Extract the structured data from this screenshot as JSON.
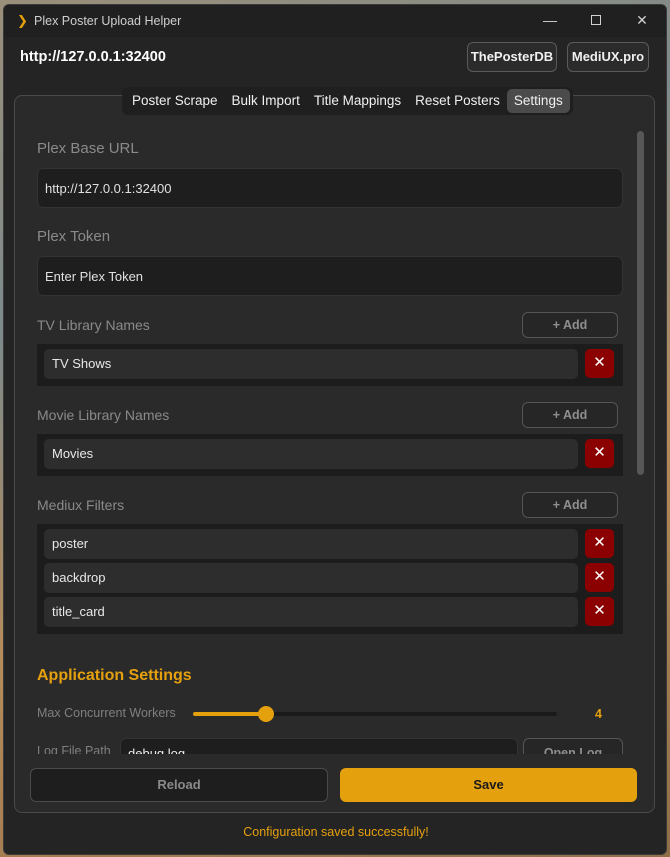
{
  "window": {
    "title": "Plex Poster Upload Helper",
    "icon": "plex-chevron-icon",
    "controls": {
      "minimize": "—",
      "close": "✕"
    }
  },
  "header": {
    "server_url": "http://127.0.0.1:32400",
    "buttons": {
      "theposterdb": "ThePosterDB",
      "mediux": "MediUX.pro"
    }
  },
  "tabs": [
    {
      "label": "Poster Scrape",
      "active": false
    },
    {
      "label": "Bulk Import",
      "active": false
    },
    {
      "label": "Title Mappings",
      "active": false
    },
    {
      "label": "Reset Posters",
      "active": false
    },
    {
      "label": "Settings",
      "active": true
    }
  ],
  "settings": {
    "plex_base_url": {
      "label": "Plex Base URL",
      "value": "http://127.0.0.1:32400"
    },
    "plex_token": {
      "label": "Plex Token",
      "placeholder": "Enter Plex Token"
    },
    "tv_libraries": {
      "label": "TV Library Names",
      "add_label": "+ Add",
      "items": [
        "TV Shows"
      ]
    },
    "movie_libraries": {
      "label": "Movie Library Names",
      "add_label": "+ Add",
      "items": [
        "Movies"
      ]
    },
    "mediux_filters": {
      "label": "Mediux Filters",
      "add_label": "+ Add",
      "items": [
        "poster",
        "backdrop",
        "title_card"
      ]
    },
    "delete_symbol": "✕"
  },
  "application_settings": {
    "heading": "Application Settings",
    "max_workers": {
      "label": "Max Concurrent Workers",
      "value": "4",
      "fraction": 0.2
    },
    "log_file": {
      "label": "Log File Path",
      "value": "debug.log",
      "button": "Open Log"
    }
  },
  "footer": {
    "reload_label": "Reload",
    "save_label": "Save",
    "status_message": "Configuration saved successfully!"
  },
  "colors": {
    "accent": "#e5a00d",
    "danger": "#8b0000",
    "background": "#242424"
  }
}
